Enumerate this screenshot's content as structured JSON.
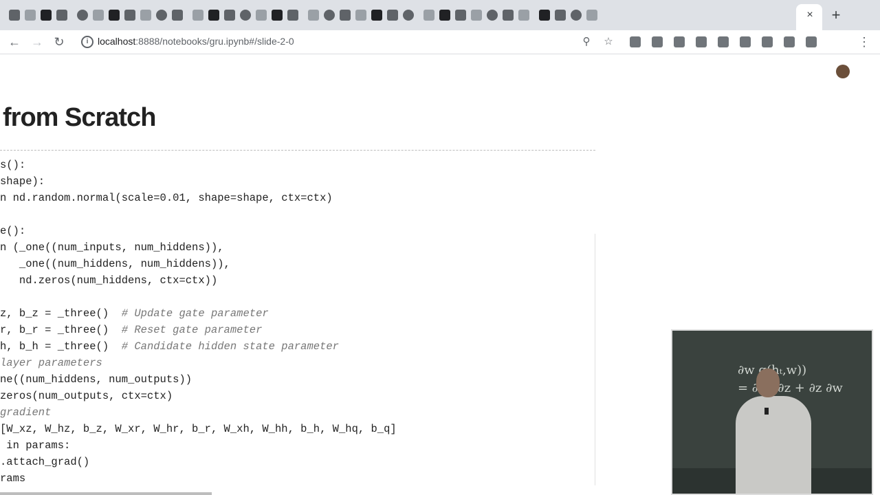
{
  "browser": {
    "url_host": "localhost",
    "url_rest": ":8888/notebooks/gru.ipynb#/slide-2-0",
    "close_tab_glyph": "×",
    "new_tab_glyph": "+"
  },
  "slide": {
    "title": "from Scratch",
    "code_lines": [
      {
        "code": "s():",
        "comment": ""
      },
      {
        "code": "shape):",
        "comment": ""
      },
      {
        "code": "n nd.random.normal(scale=0.01, shape=shape, ctx=ctx)",
        "comment": ""
      },
      {
        "code": "",
        "comment": ""
      },
      {
        "code": "e():",
        "comment": ""
      },
      {
        "code": "n (_one((num_inputs, num_hiddens)),",
        "comment": ""
      },
      {
        "code": "   _one((num_hiddens, num_hiddens)),",
        "comment": ""
      },
      {
        "code": "   nd.zeros(num_hiddens, ctx=ctx))",
        "comment": ""
      },
      {
        "code": "",
        "comment": ""
      },
      {
        "code": "z, b_z = _three()  ",
        "comment": "# Update gate parameter"
      },
      {
        "code": "r, b_r = _three()  ",
        "comment": "# Reset gate parameter"
      },
      {
        "code": "h, b_h = _three()  ",
        "comment": "# Candidate hidden state parameter"
      },
      {
        "code": "",
        "comment": "layer parameters"
      },
      {
        "code": "ne((num_hiddens, num_outputs))",
        "comment": ""
      },
      {
        "code": "zeros(num_outputs, ctx=ctx)",
        "comment": ""
      },
      {
        "code": "",
        "comment": "gradient"
      },
      {
        "code": "[W_xz, W_hz, b_z, W_xr, W_hr, b_r, W_xh, W_hh, b_h, W_hq, b_q]",
        "comment": ""
      },
      {
        "code": " in params:",
        "comment": ""
      },
      {
        "code": ".attach_grad()",
        "comment": ""
      },
      {
        "code": "rams",
        "comment": ""
      }
    ]
  },
  "video": {
    "chalk_text": "∂w g(hₜ,w))\n= ∂w [∂z + ∂z ∂w"
  },
  "icons": {
    "back": "back-arrow-icon",
    "forward": "forward-arrow-icon",
    "reload": "reload-icon",
    "site_info": "info-icon",
    "zoom": "magnifier-icon",
    "bookmark": "star-icon",
    "menu": "kebab-menu-icon"
  }
}
